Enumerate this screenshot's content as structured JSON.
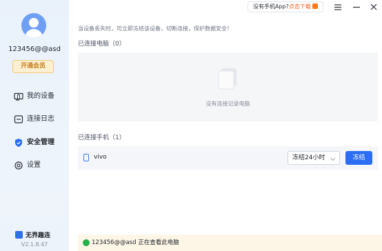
{
  "user": {
    "username": "123456@@asd",
    "vip_label": "开通会员"
  },
  "sidebar": {
    "items": [
      {
        "label": "我的设备",
        "icon": "device-icon"
      },
      {
        "label": "连接日志",
        "icon": "log-icon"
      },
      {
        "label": "安全管理",
        "icon": "shield-icon",
        "active": true
      },
      {
        "label": "设置",
        "icon": "gear-icon"
      }
    ],
    "brand": "无界趣连",
    "version": "V2.1.8.47"
  },
  "topbar": {
    "promo_question": "没有手机App?",
    "promo_link": "点击下载"
  },
  "main": {
    "hint": "当设备丢失时，可立即冻结该设备，切断连接，保护数据安全！",
    "pc_section_title": "已连接电脑（0）",
    "pc_empty_text": "没有连接记录电脑",
    "phone_section_title": "已连接手机（1）",
    "phones": [
      {
        "name": "vivo",
        "freeze_duration": "冻结24小时",
        "freeze_label": "冻结"
      }
    ]
  },
  "status": {
    "user": "123456@@asd",
    "text": "正在查看此电脑"
  },
  "colors": {
    "accent": "#2b6ef2",
    "status_green": "#24b14c",
    "promo_orange": "#ff5a1f"
  }
}
